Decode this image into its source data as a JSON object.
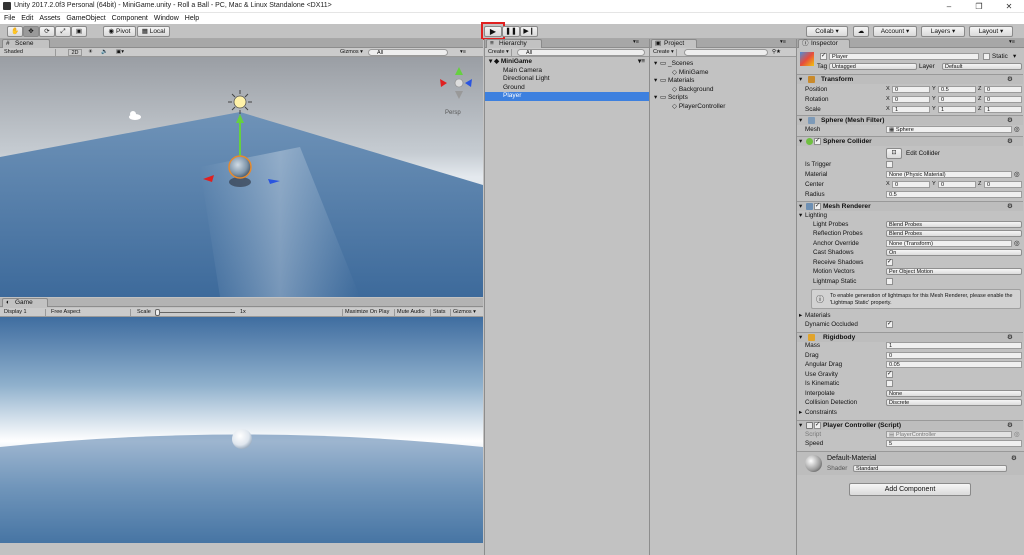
{
  "window": {
    "title": "Unity 2017.2.0f3 Personal (64bit) - MiniGame.unity - Roll a Ball - PC, Mac & Linux Standalone <DX11>",
    "min": "–",
    "max": "❐",
    "close": "✕"
  },
  "menu": [
    "File",
    "Edit",
    "Assets",
    "GameObject",
    "Component",
    "Window",
    "Help"
  ],
  "toolbar": {
    "pivot": "Pivot",
    "local": "Local",
    "collab": "Collab ▾",
    "account": "Account",
    "layers": "Layers",
    "layout": "Layout"
  },
  "scene": {
    "tab": "Scene",
    "shading": "Shaded",
    "mode2d": "2D",
    "gizmos": "Gizmos ▾",
    "search": "All",
    "persp": "Persp"
  },
  "game": {
    "tab": "Game",
    "display": "Display 1",
    "aspect": "Free Aspect",
    "scale_label": "Scale",
    "scale_value": "1x",
    "maximize": "Maximize On Play",
    "mute": "Mute Audio",
    "stats": "Stats",
    "gizmos": "Gizmos ▾"
  },
  "hierarchy": {
    "tab": "Hierarchy",
    "create": "Create ▾",
    "search": "All",
    "scene": "MiniGame",
    "items": [
      "Main Camera",
      "Directional Light",
      "Ground",
      "Player"
    ],
    "selected": "Player"
  },
  "project": {
    "tab": "Project",
    "create": "Create ▾",
    "items": [
      {
        "label": "_Scenes",
        "level": 1,
        "arrow": "▾"
      },
      {
        "label": "MiniGame",
        "level": 2,
        "arrow": ""
      },
      {
        "label": "Materials",
        "level": 1,
        "arrow": "▾"
      },
      {
        "label": "Background",
        "level": 2,
        "arrow": ""
      },
      {
        "label": "Scripts",
        "level": 1,
        "arrow": "▾"
      },
      {
        "label": "PlayerController",
        "level": 2,
        "arrow": ""
      }
    ]
  },
  "inspector": {
    "tab": "Inspector",
    "object_name": "Player",
    "static": "Static",
    "tag_label": "Tag",
    "tag": "Untagged",
    "layer_label": "Layer",
    "layer": "Default",
    "transform": {
      "title": "Transform",
      "position_label": "Position",
      "rotation_label": "Rotation",
      "scale_label": "Scale",
      "position": [
        "0",
        "0.5",
        "0"
      ],
      "rotation": [
        "0",
        "0",
        "0"
      ],
      "scale": [
        "1",
        "1",
        "1"
      ]
    },
    "mesh_filter": {
      "title": "Sphere (Mesh Filter)",
      "mesh_label": "Mesh",
      "mesh": "Sphere"
    },
    "collider": {
      "title": "Sphere Collider",
      "edit": "Edit Collider",
      "trigger_label": "Is Trigger",
      "material_label": "Material",
      "material": "None (Physic Material)",
      "center_label": "Center",
      "center": [
        "0",
        "0",
        "0"
      ],
      "radius_label": "Radius",
      "radius": "0.5"
    },
    "renderer": {
      "title": "Mesh Renderer",
      "lighting": "Lighting",
      "light_probes_label": "Light Probes",
      "light_probes": "Blend Probes",
      "reflection_label": "Reflection Probes",
      "reflection": "Blend Probes",
      "anchor_label": "Anchor Override",
      "anchor": "None (Transform)",
      "cast_label": "Cast Shadows",
      "cast": "On",
      "receive_label": "Receive Shadows",
      "motion_label": "Motion Vectors",
      "motion": "Per Object Motion",
      "lightmap_label": "Lightmap Static",
      "info": "To enable generation of lightmaps for this Mesh Renderer, please enable the 'Lightmap Static' property.",
      "materials": "Materials",
      "occluded_label": "Dynamic Occluded"
    },
    "rigidbody": {
      "title": "Rigidbody",
      "mass_label": "Mass",
      "mass": "1",
      "drag_label": "Drag",
      "drag": "0",
      "ang_label": "Angular Drag",
      "ang": "0.05",
      "gravity_label": "Use Gravity",
      "kinematic_label": "Is Kinematic",
      "interp_label": "Interpolate",
      "interp": "None",
      "coll_label": "Collision Detection",
      "coll": "Discrete",
      "constraints": "Constraints"
    },
    "controller": {
      "title": "Player Controller (Script)",
      "script_label": "Script",
      "script": "PlayerController",
      "speed_label": "Speed",
      "speed": "5"
    },
    "material": {
      "name": "Default-Material",
      "shader_label": "Shader",
      "shader": "Standard"
    },
    "add_component": "Add Component"
  },
  "colors": {
    "selection": "#3d80df",
    "play_highlight": "#e02020",
    "sky": "#d9e4ee",
    "ground": "#3f6d9f"
  }
}
